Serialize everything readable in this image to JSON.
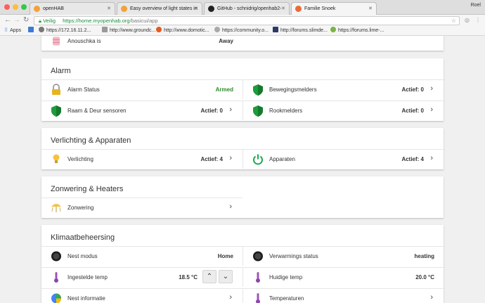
{
  "browser": {
    "tabs": [
      {
        "title": "openHAB"
      },
      {
        "title": "Easy overview of light states in"
      },
      {
        "title": "GitHub - schnidrig/openhab2-"
      },
      {
        "title": "Familie Snoek"
      }
    ],
    "user": "Roel",
    "secure_label": "Veilig",
    "url_host": "https://home.myopenhab.org",
    "url_path": "/basicui/app",
    "bookmarks": [
      {
        "label": "Apps"
      },
      {
        "label": "https://172.16.11.2..."
      },
      {
        "label": "http://www.groundc..."
      },
      {
        "label": "http://www.domotic..."
      },
      {
        "label": "https://community.o..."
      },
      {
        "label": "http://forums.slimde..."
      },
      {
        "label": "https://forums.lime-..."
      }
    ]
  },
  "top_row": {
    "label": "Anouschka is",
    "value": "Away"
  },
  "alarm": {
    "title": "Alarm",
    "alarm_status": {
      "label": "Alarm Status",
      "value": "Armed"
    },
    "bewegingsmelders": {
      "label": "Bewegingsmelders",
      "value": "Actief: 0"
    },
    "raam_deur": {
      "label": "Raam & Deur sensoren",
      "value": "Actief: 0"
    },
    "rookmelders": {
      "label": "Rookmelders",
      "value": "Actief: 0"
    }
  },
  "verlichting": {
    "title": "Verlichting & Apparaten",
    "verlichting": {
      "label": "Verlichting",
      "value": "Actief: 4"
    },
    "apparaten": {
      "label": "Apparaten",
      "value": "Actief: 4"
    }
  },
  "zonwering": {
    "title": "Zonwering & Heaters",
    "zonwering": {
      "label": "Zonwering"
    }
  },
  "klimaat": {
    "title": "Klimaatbeheersing",
    "nest_modus": {
      "label": "Nest modus",
      "value": "Home"
    },
    "verwarmings_status": {
      "label": "Verwarmings status",
      "value": "heating"
    },
    "ingestelde_temp": {
      "label": "Ingestelde temp",
      "value": "18.5 °C"
    },
    "huidige_temp": {
      "label": "Huidige temp",
      "value": "20.0 °C"
    },
    "nest_informatie": {
      "label": "Nest informatie"
    },
    "temperaturen": {
      "label": "Temperaturen"
    }
  },
  "colors": {
    "armed": "#2e8b2e",
    "secure": "#1a8e3c",
    "shield": "#1e9b3c",
    "power": "#1aa84a"
  }
}
